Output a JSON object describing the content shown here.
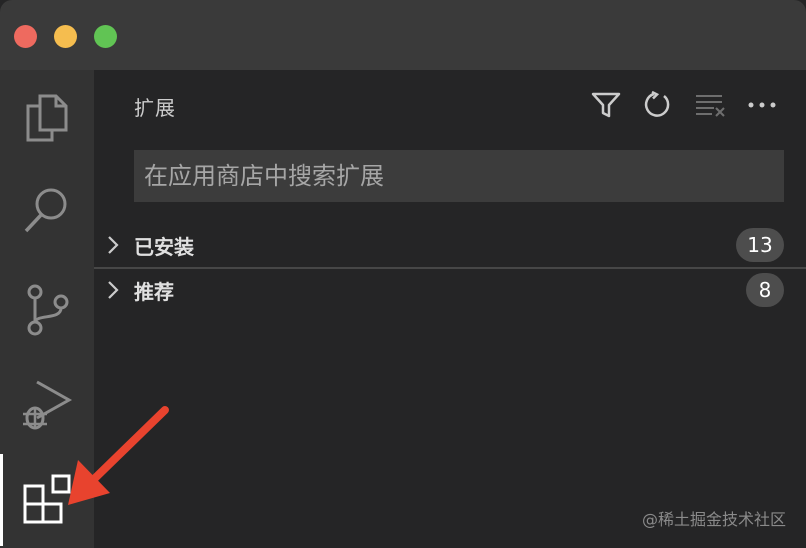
{
  "sidebar": {
    "title": "扩展",
    "search_placeholder": "在应用商店中搜索扩展",
    "sections": [
      {
        "label": "已安装",
        "count": "13"
      },
      {
        "label": "推荐",
        "count": "8"
      }
    ]
  },
  "toolbar_icons": [
    "filter-icon",
    "refresh-icon",
    "clear-icon",
    "more-icon"
  ],
  "activity_icons": [
    "explorer-icon",
    "search-icon",
    "source-control-icon",
    "run-debug-icon",
    "extensions-icon"
  ],
  "watermark": "@稀土掘金技术社区",
  "colors": {
    "accent_arrow": "#e8432e",
    "titlebar": "#3a3a3a",
    "activitybar": "#333333",
    "sidebar": "#252526"
  }
}
